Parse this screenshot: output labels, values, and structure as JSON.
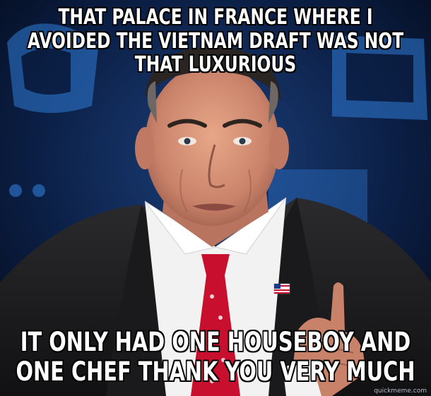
{
  "meme": {
    "top_text": "THAT PALACE IN FRANCE WHERE I AVOIDED THE VIETNAM DRAFT WAS NOT THAT LUXURIOUS",
    "bottom_text": "IT ONLY HAD ONE HOUSEBOY AND ONE CHEF THANK YOU VERY MUCH",
    "watermark": "quickmeme.com"
  },
  "colors": {
    "caption_fill": "#ffffff",
    "caption_outline": "#000000",
    "backdrop": "#0a1a3a",
    "accent_blue": "#2f7bd6",
    "tie_red": "#c8102e"
  }
}
